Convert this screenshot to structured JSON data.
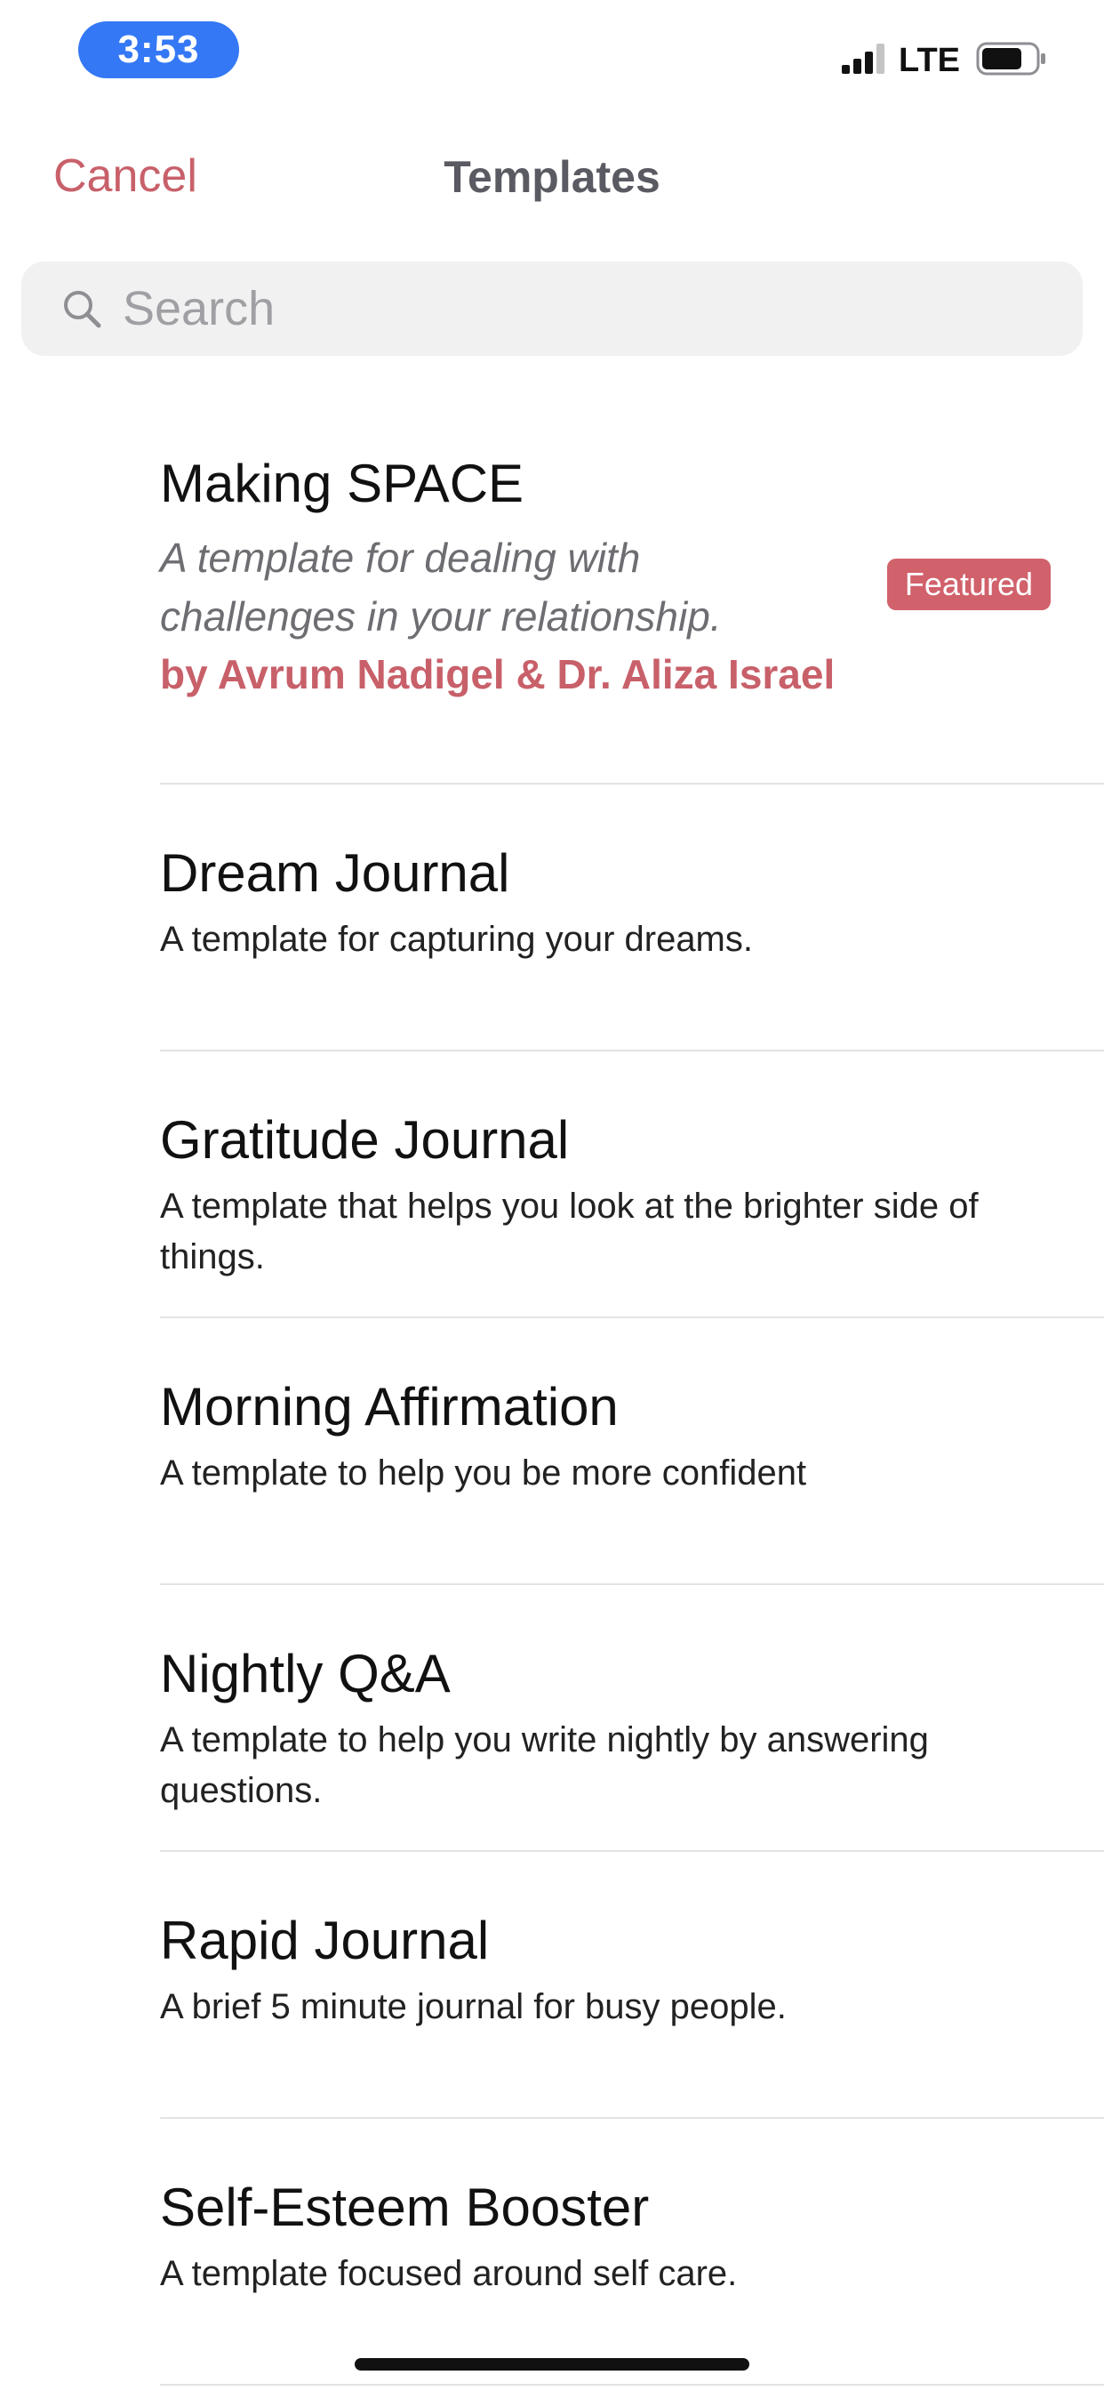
{
  "status_bar": {
    "time": "3:53",
    "network": "LTE",
    "icons": [
      "signal-icon",
      "battery-icon"
    ]
  },
  "nav": {
    "cancel_label": "Cancel",
    "title": "Templates"
  },
  "search": {
    "placeholder": "Search",
    "value": "",
    "icon": "search-icon"
  },
  "colors": {
    "accent": "#c8606a",
    "badge": "#d1616b",
    "time_pill": "#3478f6"
  },
  "templates": [
    {
      "title": "Making SPACE",
      "description": "A template for dealing with challenges in your relationship.",
      "author": "by Avrum Nadigel & Dr. Aliza Israel",
      "badge": "Featured"
    },
    {
      "title": "Dream Journal",
      "description": "A template for capturing your dreams."
    },
    {
      "title": "Gratitude Journal",
      "description": "A template that helps you look at the brighter side of things."
    },
    {
      "title": "Morning Affirmation",
      "description": "A template to help you be more confident"
    },
    {
      "title": "Nightly Q&A",
      "description": "A template to help you write nightly by answering questions."
    },
    {
      "title": "Rapid Journal",
      "description": "A brief 5 minute journal for busy people."
    },
    {
      "title": "Self-Esteem Booster",
      "description": "A template focused around self care."
    }
  ]
}
